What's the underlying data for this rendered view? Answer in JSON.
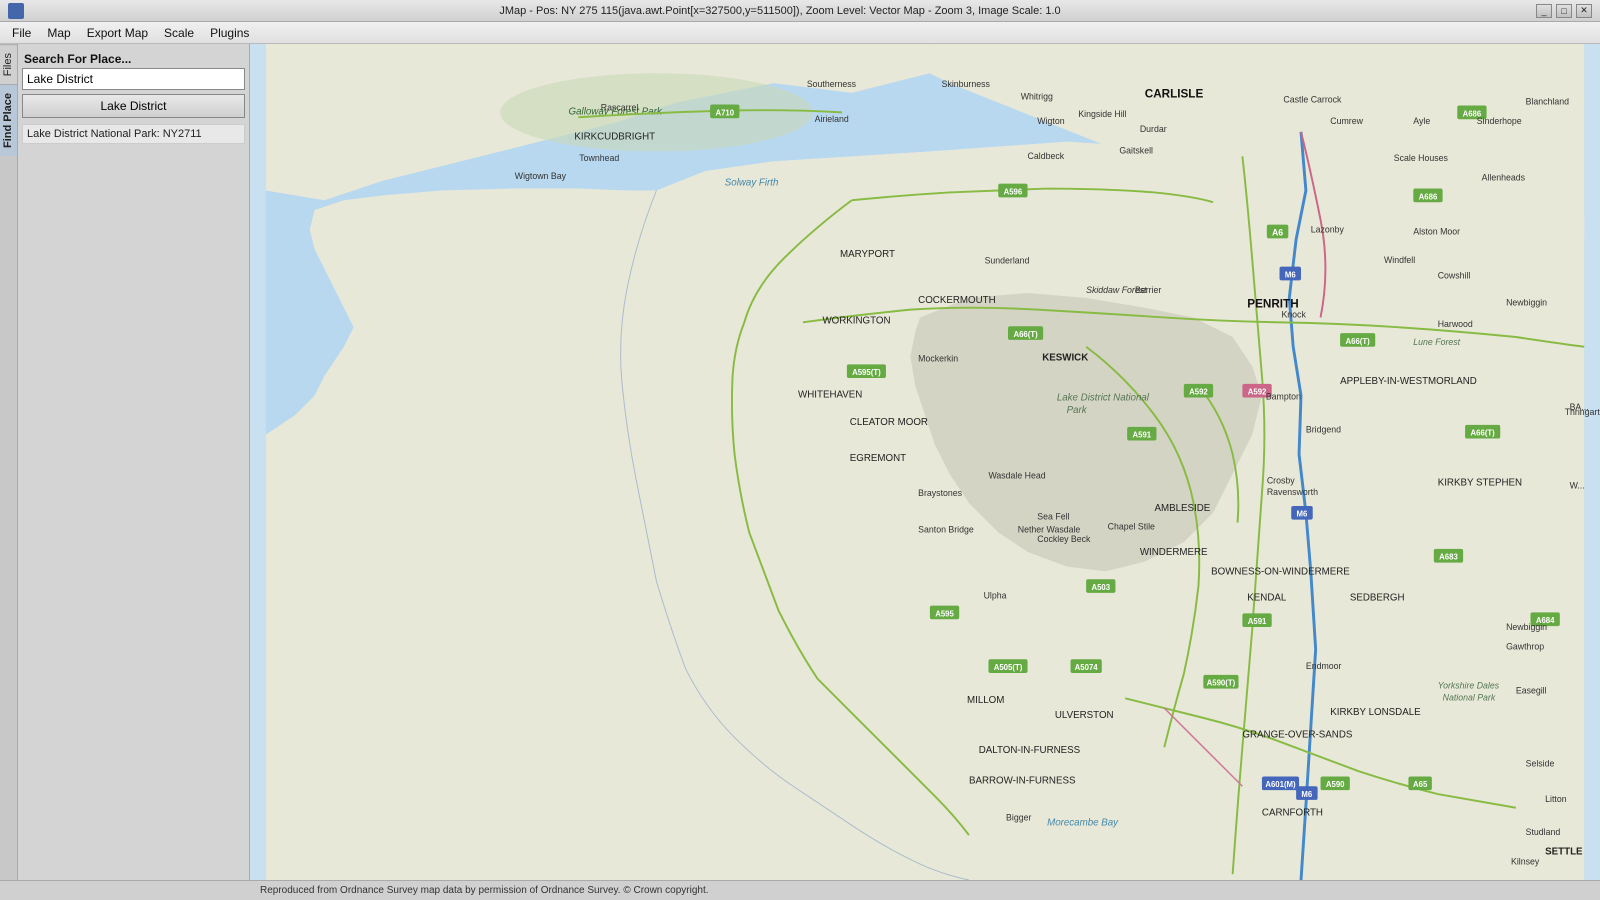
{
  "titlebar": {
    "title": "JMap - Pos: NY 275 115(java.awt.Point[x=327500,y=511500]), Zoom Level: Vector Map - Zoom 3, Image Scale: 1.0",
    "btn_minimize": "_",
    "btn_maximize": "□",
    "btn_close": "✕"
  },
  "menubar": {
    "items": [
      "File",
      "Map",
      "Export Map",
      "Scale",
      "Plugins"
    ]
  },
  "sidebar": {
    "tabs": [
      {
        "label": "Files",
        "active": false
      },
      {
        "label": "Find Place",
        "active": true
      }
    ]
  },
  "search_panel": {
    "label": "Search For Place...",
    "input_value": "Lake District",
    "button_label": "Lake District",
    "result": "Lake District National Park: NY2711"
  },
  "statusbar": {
    "text": "Reproduced from Ordnance Survey map data by permission of Ordnance Survey. © Crown copyright."
  },
  "map": {
    "places": [
      {
        "name": "CARLISLE",
        "type": "city"
      },
      {
        "name": "PENRITH",
        "type": "city"
      },
      {
        "name": "WORKINGTON",
        "type": "town"
      },
      {
        "name": "WHITEHAVEN",
        "type": "town"
      },
      {
        "name": "COCKERMOUTH",
        "type": "town"
      },
      {
        "name": "KESWICK",
        "type": "town"
      },
      {
        "name": "MARYPORT",
        "type": "town"
      },
      {
        "name": "CLEATOR MOOR",
        "type": "town"
      },
      {
        "name": "EGREMONT",
        "type": "town"
      },
      {
        "name": "WINDERMERE",
        "type": "town"
      },
      {
        "name": "BOWNESS-ON-WINDERMERE",
        "type": "town"
      },
      {
        "name": "AMBLESIDE",
        "type": "town"
      },
      {
        "name": "KENDAL",
        "type": "town"
      },
      {
        "name": "SEDBERGH",
        "type": "town"
      },
      {
        "name": "MILLOM",
        "type": "town"
      },
      {
        "name": "ULVERSTON",
        "type": "town"
      },
      {
        "name": "BARROW-IN-FURNESS",
        "type": "town"
      },
      {
        "name": "DALTON-IN-FURNESS",
        "type": "town"
      },
      {
        "name": "KIRKBY LONSDALE",
        "type": "town"
      },
      {
        "name": "GRANGE-OVER-SANDS",
        "type": "town"
      },
      {
        "name": "CARNFORTH",
        "type": "town"
      },
      {
        "name": "APPLEBY-IN-WESTMORLAND",
        "type": "town"
      },
      {
        "name": "KIRKBY STEPHEN",
        "type": "town"
      },
      {
        "name": "KIRKCUDBRIGHT",
        "type": "town"
      },
      {
        "name": "Galloway Forest Park",
        "type": "park"
      },
      {
        "name": "Lake District National Park",
        "type": "park"
      },
      {
        "name": "Yorkshire Dales National Park",
        "type": "park"
      },
      {
        "name": "Skiddaw Forest",
        "type": "forest"
      },
      {
        "name": "Lune Forest",
        "type": "forest"
      },
      {
        "name": "Solway Firth",
        "type": "water"
      },
      {
        "name": "Morecambe Bay",
        "type": "water"
      },
      {
        "name": "Sea Fell",
        "type": "highland"
      },
      {
        "name": "Wasdale Head",
        "type": "village"
      },
      {
        "name": "Mockerkin",
        "type": "village"
      },
      {
        "name": "Braystones",
        "type": "village"
      },
      {
        "name": "Santon Bridge",
        "type": "village"
      },
      {
        "name": "Cockley Beck",
        "type": "village"
      },
      {
        "name": "Chapel Stile",
        "type": "village"
      },
      {
        "name": "Nether Wasdale",
        "type": "village"
      },
      {
        "name": "Ulpha",
        "type": "village"
      },
      {
        "name": "Bampton",
        "type": "village"
      },
      {
        "name": "Bridgend",
        "type": "village"
      },
      {
        "name": "Endmoor",
        "type": "village"
      },
      {
        "name": "Bigger",
        "type": "village"
      }
    ]
  }
}
